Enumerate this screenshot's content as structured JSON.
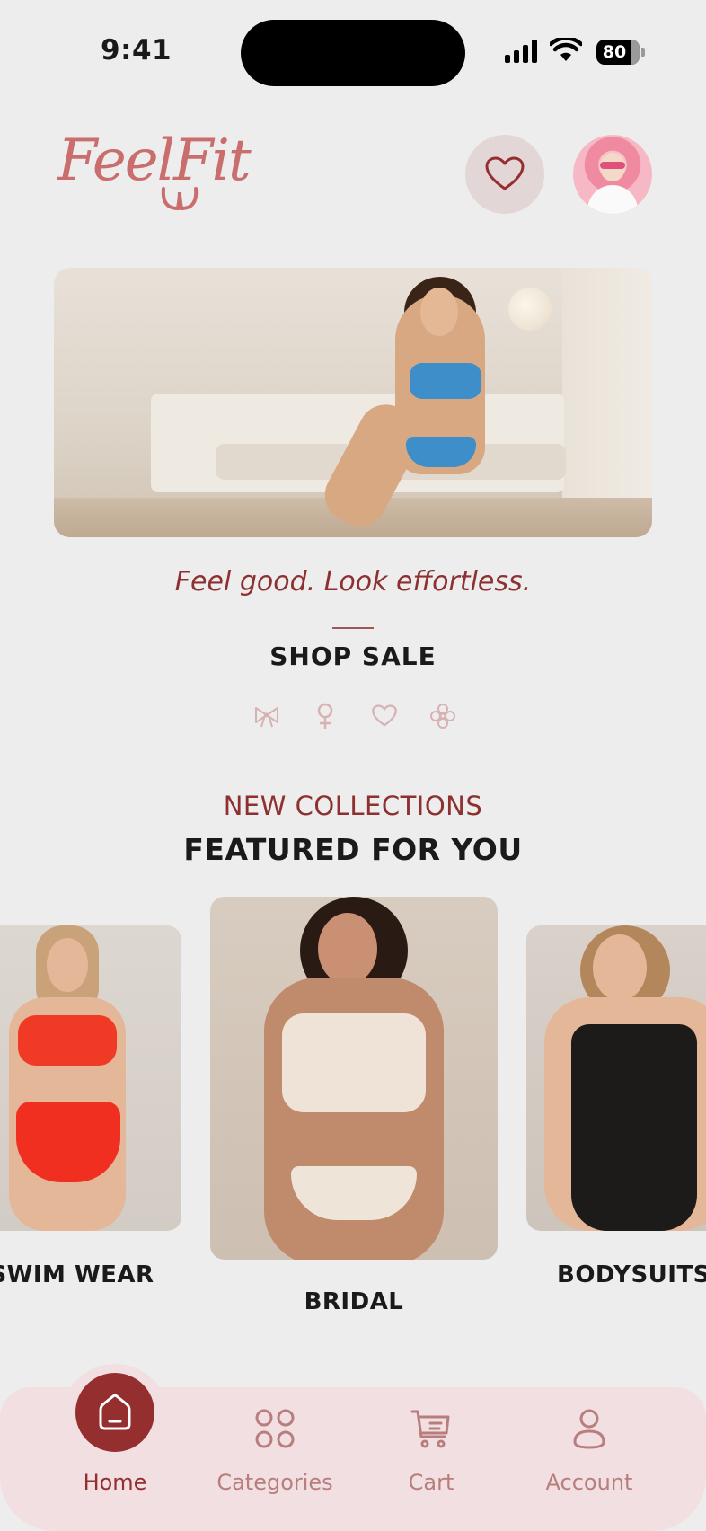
{
  "status_bar": {
    "time": "9:41",
    "battery": "80"
  },
  "header": {
    "logo_text": "FeelFit",
    "favorites_icon": "heart-icon",
    "avatar_icon": "profile-avatar"
  },
  "hero": {
    "tagline": "Feel good. Look effortless.",
    "cta_label": "SHOP SALE",
    "mini_icons": [
      "bow-icon",
      "female-icon",
      "heart-icon",
      "flower-icon"
    ]
  },
  "featured": {
    "kicker": "NEW COLLECTIONS",
    "title": "FEATURED FOR YOU",
    "cards": [
      {
        "label": "SWIM WEAR"
      },
      {
        "label": "BRIDAL"
      },
      {
        "label": "BODYSUITS"
      }
    ]
  },
  "bottom_nav": {
    "items": [
      {
        "label": "Home",
        "icon": "home-icon",
        "active": true
      },
      {
        "label": "Categories",
        "icon": "grid-icon",
        "active": false
      },
      {
        "label": "Cart",
        "icon": "cart-icon",
        "active": false
      },
      {
        "label": "Account",
        "icon": "user-icon",
        "active": false
      }
    ]
  },
  "colors": {
    "accent": "#952e2e",
    "logo": "#c96d6d",
    "nav_bg": "#f2dfe1",
    "background": "#ededed"
  }
}
